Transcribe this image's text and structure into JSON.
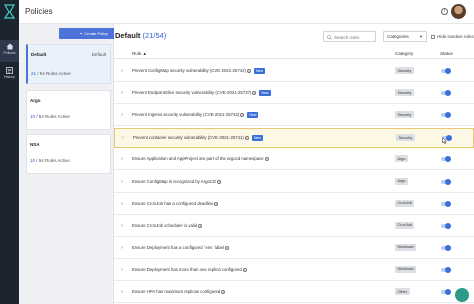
{
  "app": {
    "title": "Policies"
  },
  "nav": [
    {
      "label": "Policies",
      "icon": "home-icon",
      "active": true
    },
    {
      "label": "History",
      "icon": "history-icon",
      "active": false
    }
  ],
  "sidebar": {
    "create_button": "Create Policy",
    "policies": [
      {
        "name": "Default",
        "default_label": "Default",
        "active": "21",
        "rules_suffix": " / 54 Rules Active",
        "selected": true
      },
      {
        "name": "Argo",
        "default_label": "",
        "active": "10",
        "rules_suffix": " / 54 Rules Active",
        "selected": false
      },
      {
        "name": "NSA",
        "default_label": "",
        "active": "10",
        "rules_suffix": " / 54 Rules Active",
        "selected": false
      }
    ]
  },
  "main": {
    "title_name": "Default",
    "title_count_open": "(",
    "title_active": "21",
    "title_count_rest": "/54)",
    "search_placeholder": "Search rules",
    "category_select": "Categories",
    "hide_inactive": "Hide inactive rules",
    "columns": {
      "rule": "Rule",
      "category": "Category",
      "status": "Status"
    },
    "rows": [
      {
        "rule": "Prevent ConfigMap security vulnerability (CVE-2021-25742)",
        "new": true,
        "category": "Security",
        "highlight": false
      },
      {
        "rule": "Prevent EndpointSlice security vulnerability (CVE-2021-25737)",
        "new": true,
        "category": "Security",
        "highlight": false
      },
      {
        "rule": "Prevent Ingress security vulnerability (CVE-2021-25742)",
        "new": true,
        "category": "Security",
        "highlight": false
      },
      {
        "rule": "Prevent container security vulnerability (CVE-2021-25741)",
        "new": true,
        "category": "Security",
        "highlight": true
      },
      {
        "rule": "Ensure Application and AppProject are part of the argocd namespace",
        "new": false,
        "category": "Argo",
        "highlight": false
      },
      {
        "rule": "Ensure ConfigMap is recognized by ArgoCD",
        "new": false,
        "category": "Argo",
        "highlight": false
      },
      {
        "rule": "Ensure CronJob has a configured deadline",
        "new": false,
        "category": "CronJob",
        "highlight": false
      },
      {
        "rule": "Ensure CronJob scheduler is valid",
        "new": false,
        "category": "CronJob",
        "highlight": false
      },
      {
        "rule": "Ensure Deployment has a configured `env` label",
        "new": false,
        "category": "Workload",
        "highlight": false
      },
      {
        "rule": "Ensure Deployment has more than one replica configured",
        "new": false,
        "category": "Workload",
        "highlight": false
      },
      {
        "rule": "Ensure HPA has maximum replicas configured",
        "new": false,
        "category": "Other",
        "highlight": false
      }
    ],
    "new_badge": "New",
    "sort_indicator": "▲",
    "rule_status_on": true
  },
  "colors": {
    "accent": "#4d73d9",
    "nav_bg": "#1c2430",
    "toggle_on": "#3a6fd8",
    "highlight_row": "#fdf7e6"
  }
}
